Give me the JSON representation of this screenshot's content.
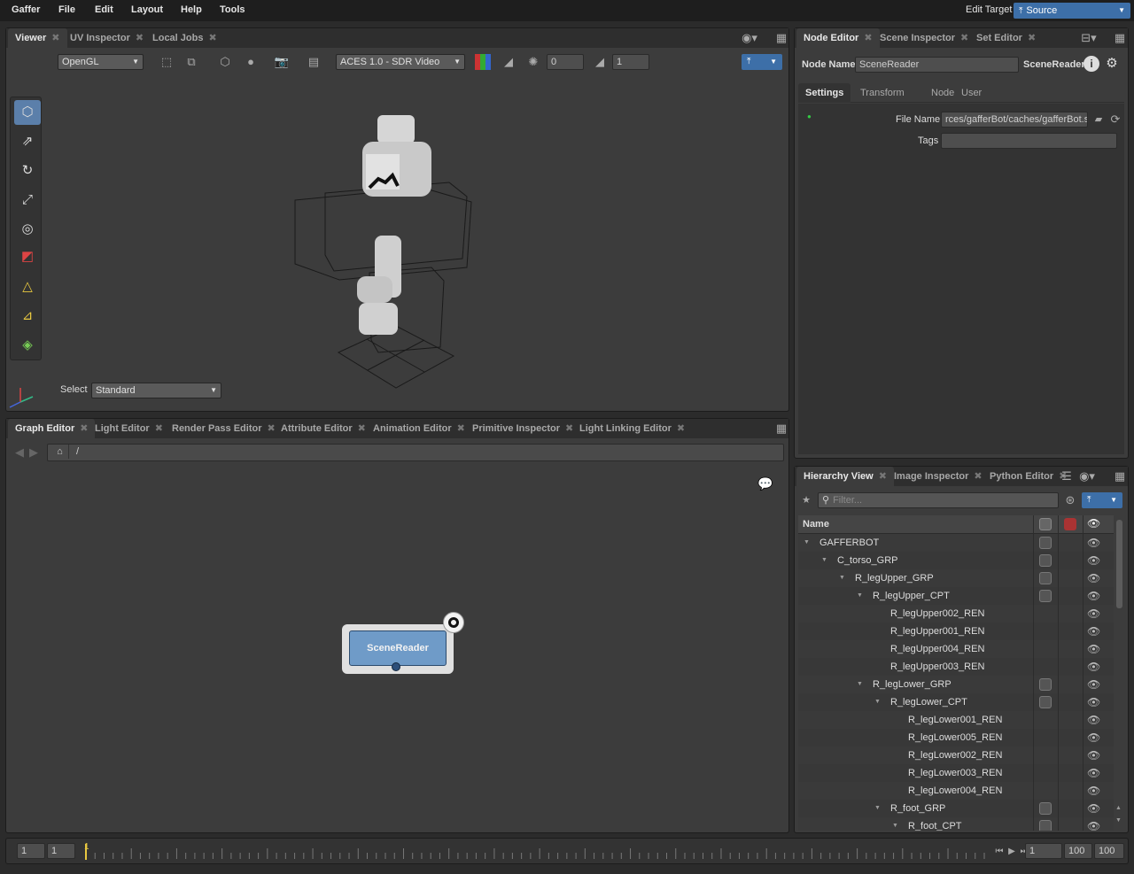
{
  "menubar": {
    "items": [
      "Gaffer",
      "File",
      "Edit",
      "Layout",
      "Help",
      "Tools"
    ],
    "edit_target_label": "Edit Target",
    "edit_target_value": "Source"
  },
  "viewer_panel": {
    "tabs": [
      {
        "label": "Viewer",
        "active": true
      },
      {
        "label": "UV Inspector",
        "active": false
      },
      {
        "label": "Local Jobs",
        "active": false
      }
    ],
    "renderer": "OpenGL",
    "display_transform": "ACES 1.0 - SDR Video",
    "exposure": "0",
    "gamma": "1",
    "select_label": "Select",
    "select_value": "Standard"
  },
  "graph_panel": {
    "tabs": [
      {
        "label": "Graph Editor",
        "active": true
      },
      {
        "label": "Light Editor",
        "active": false
      },
      {
        "label": "Render Pass Editor",
        "active": false
      },
      {
        "label": "Attribute Editor",
        "active": false
      },
      {
        "label": "Animation Editor",
        "active": false
      },
      {
        "label": "Primitive Inspector",
        "active": false
      },
      {
        "label": "Light Linking Editor",
        "active": false
      }
    ],
    "path": "/",
    "node_label": "SceneReader"
  },
  "node_editor": {
    "tabs": [
      {
        "label": "Node Editor",
        "active": true
      },
      {
        "label": "Scene Inspector",
        "active": false
      },
      {
        "label": "Set Editor",
        "active": false
      }
    ],
    "node_name_label": "Node Name",
    "node_name_value": "SceneReader",
    "node_type": "SceneReader",
    "section_tabs": [
      {
        "label": "Settings",
        "active": true
      },
      {
        "label": "Transform",
        "active": false
      },
      {
        "label": "Node",
        "active": false
      },
      {
        "label": "User",
        "active": false
      }
    ],
    "file_name_label": "File Name",
    "file_name_value": "rces/gafferBot/caches/gafferBot.scc",
    "tags_label": "Tags",
    "tags_value": ""
  },
  "hierarchy_panel": {
    "tabs": [
      {
        "label": "Hierarchy View",
        "active": true
      },
      {
        "label": "Image Inspector",
        "active": false
      },
      {
        "label": "Python Editor",
        "active": false
      }
    ],
    "filter_placeholder": "Filter...",
    "column_name": "Name",
    "rows": [
      {
        "name": "GAFFERBOT",
        "depth": 0,
        "expanded": true,
        "set_icon": true
      },
      {
        "name": "C_torso_GRP",
        "depth": 1,
        "expanded": true,
        "set_icon": true
      },
      {
        "name": "R_legUpper_GRP",
        "depth": 2,
        "expanded": true,
        "set_icon": true
      },
      {
        "name": "R_legUpper_CPT",
        "depth": 3,
        "expanded": true,
        "set_icon": true
      },
      {
        "name": "R_legUpper002_REN",
        "depth": 4,
        "expanded": false,
        "set_icon": false
      },
      {
        "name": "R_legUpper001_REN",
        "depth": 4,
        "expanded": false,
        "set_icon": false
      },
      {
        "name": "R_legUpper004_REN",
        "depth": 4,
        "expanded": false,
        "set_icon": false
      },
      {
        "name": "R_legUpper003_REN",
        "depth": 4,
        "expanded": false,
        "set_icon": false
      },
      {
        "name": "R_legLower_GRP",
        "depth": 3,
        "expanded": true,
        "set_icon": true
      },
      {
        "name": "R_legLower_CPT",
        "depth": 4,
        "expanded": true,
        "set_icon": true
      },
      {
        "name": "R_legLower001_REN",
        "depth": 5,
        "expanded": false,
        "set_icon": false
      },
      {
        "name": "R_legLower005_REN",
        "depth": 5,
        "expanded": false,
        "set_icon": false
      },
      {
        "name": "R_legLower002_REN",
        "depth": 5,
        "expanded": false,
        "set_icon": false
      },
      {
        "name": "R_legLower003_REN",
        "depth": 5,
        "expanded": false,
        "set_icon": false
      },
      {
        "name": "R_legLower004_REN",
        "depth": 5,
        "expanded": false,
        "set_icon": false
      },
      {
        "name": "R_foot_GRP",
        "depth": 4,
        "expanded": true,
        "set_icon": true
      },
      {
        "name": "R_foot_CPT",
        "depth": 5,
        "expanded": true,
        "set_icon": true
      }
    ]
  },
  "timeline": {
    "start_outer": "1",
    "start_inner": "1",
    "current_frame": "1",
    "current_frame_field": "1",
    "end_inner": "100",
    "end_outer": "100"
  },
  "colors": {
    "accent": "#3d6fa8",
    "node_fill": "#6f9bc8",
    "active_tool": "#5b7faa"
  }
}
